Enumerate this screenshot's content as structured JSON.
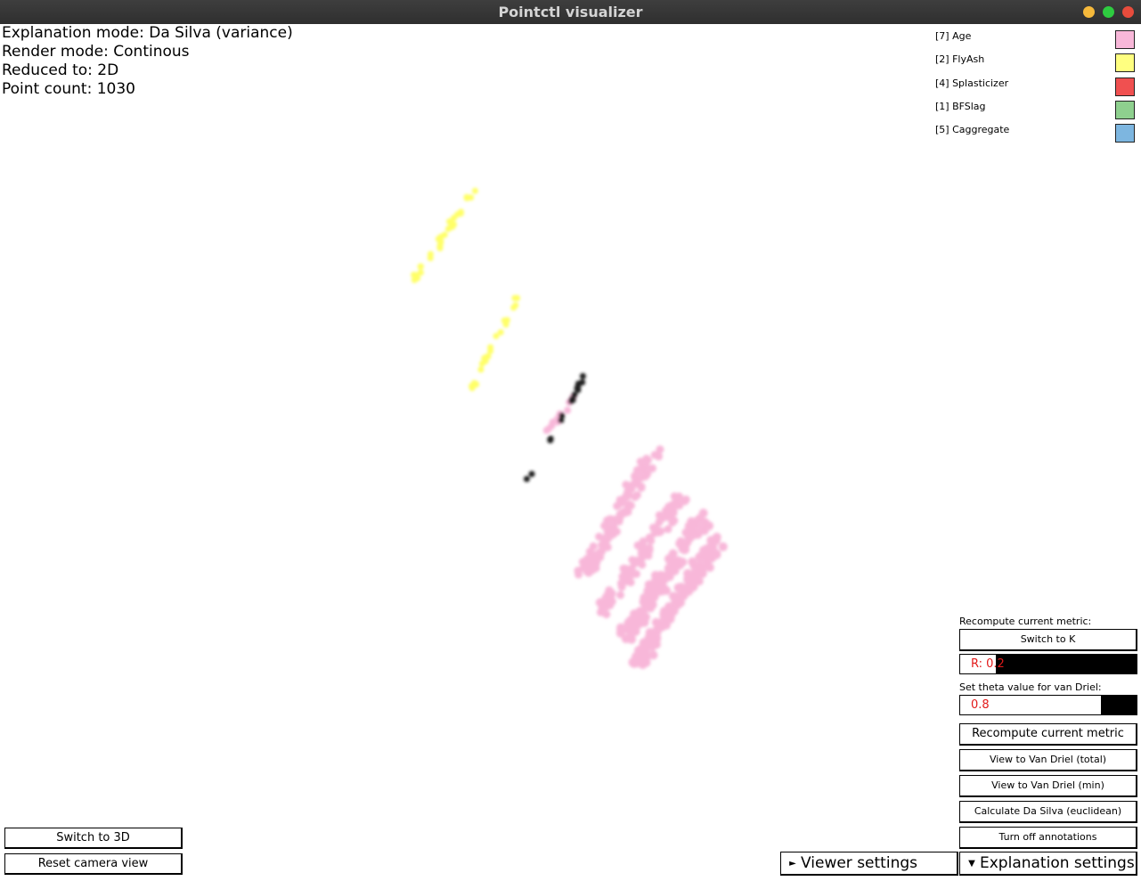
{
  "window": {
    "title": "Pointctl visualizer"
  },
  "info": {
    "explanation_mode": "Explanation mode: Da Silva (variance)",
    "render_mode": "Render mode: Continous",
    "reduced_to": "Reduced to: 2D",
    "point_count": "Point count: 1030"
  },
  "legend": [
    {
      "label": "[7] Age",
      "color": "#f8b7d9"
    },
    {
      "label": "[2] FlyAsh",
      "color": "#ffff80"
    },
    {
      "label": "[4] Splasticizer",
      "color": "#f05050"
    },
    {
      "label": "[1] BFSlag",
      "color": "#8ed08e"
    },
    {
      "label": "[5] Caggregate",
      "color": "#7db6e0"
    }
  ],
  "right_panel": {
    "recompute_label": "Recompute current metric:",
    "switch_to_k": "Switch to K",
    "r_field": "R: 0.2",
    "r_fraction": 0.2,
    "theta_label": "Set theta value for van Driel:",
    "theta_field": "0.8",
    "theta_fraction": 0.8,
    "recompute_button": "Recompute current metric",
    "view_van_driel_total": "View to Van Driel (total)",
    "view_van_driel_min": "View to Van Driel (min)",
    "calc_da_silva": "Calculate Da Silva (euclidean)",
    "turn_off_annotations": "Turn off annotations"
  },
  "left_buttons": {
    "switch_3d": "Switch to 3D",
    "reset_camera": "Reset camera view"
  },
  "bottom": {
    "viewer_settings": "Viewer settings",
    "viewer_icon": "collapsed-arrow-icon",
    "explanation_settings": "Explanation settings",
    "explanation_icon": "expanded-arrow-icon"
  },
  "colors": {
    "age": "#f8b7d9",
    "flyash": "#ffff66",
    "dark": "#1a1a1a",
    "accent_text": "#e21a1a"
  }
}
